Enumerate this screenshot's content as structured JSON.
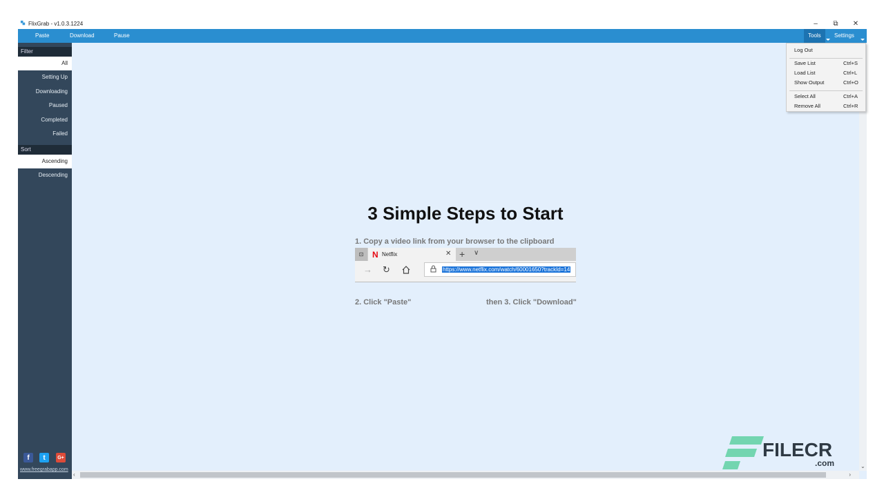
{
  "titlebar": {
    "title": "FlixGrab - v1.0.3.1224",
    "minimize": "–",
    "restore": "⧉",
    "close": "✕"
  },
  "menubar": {
    "paste": "Paste",
    "download": "Download",
    "pause": "Pause",
    "tools": "Tools",
    "settings": "Settings"
  },
  "sidebar": {
    "filter_header": "Filter",
    "filter_items": [
      "All",
      "Setting Up",
      "Downloading",
      "Paused",
      "Completed",
      "Failed"
    ],
    "sort_header": "Sort",
    "sort_items": [
      "Ascending",
      "Descending"
    ],
    "social": {
      "facebook": "f",
      "twitter": "t",
      "google": "G+"
    },
    "site_link": "www.freegrabapp.com"
  },
  "main": {
    "title": "3 Simple Steps to Start",
    "step1": "1. Copy a video link from your browser to the clipboard",
    "step2": "2. Click \"Paste\"",
    "step3": "then 3. Click \"Download\"",
    "browser": {
      "tab_label": "Netflix",
      "url": "https://www.netflix.com/watch/60001650?trackId=14"
    }
  },
  "tools_menu": {
    "items": [
      {
        "label": "Log Out",
        "shortcut": ""
      },
      {
        "label": "Save List",
        "shortcut": "Ctrl+S"
      },
      {
        "label": "Load List",
        "shortcut": "Ctrl+L"
      },
      {
        "label": "Show Output",
        "shortcut": "Ctrl+O"
      },
      {
        "label": "Select All",
        "shortcut": "Ctrl+A"
      },
      {
        "label": "Remove All",
        "shortcut": "Ctrl+R"
      }
    ]
  },
  "watermark": {
    "text": "FILECR",
    "suffix": ".com"
  },
  "colors": {
    "menubar": "#2a8ed0",
    "sidebar": "#33475b",
    "content_bg": "#e3effc",
    "url_highlight": "#1a73d9",
    "netflix": "#e50914"
  }
}
